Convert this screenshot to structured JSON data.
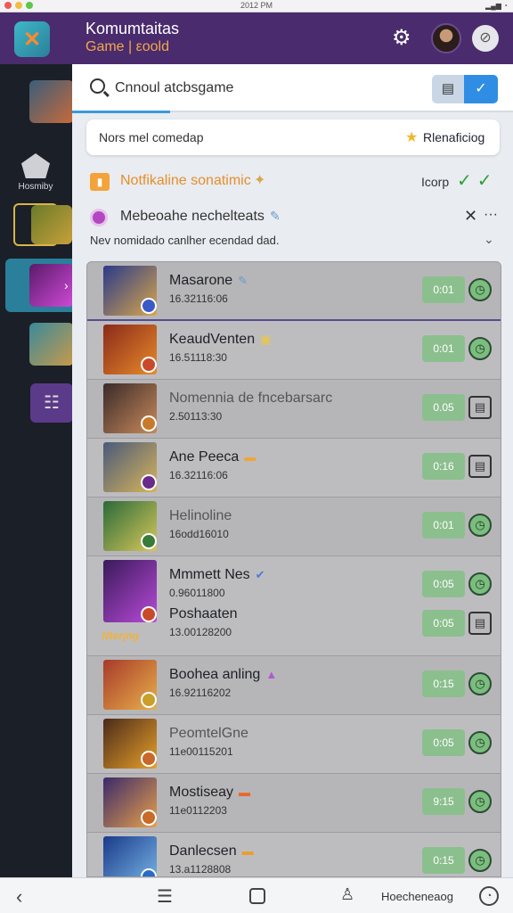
{
  "system": {
    "clock": "2012 PM"
  },
  "header": {
    "title": "Komumtaitas",
    "subtitle": "Game | εoold",
    "logo_icon": "sword-cross-icon",
    "colors": {
      "bar": "#4a2b6e",
      "subtitle": "#f2a84a"
    }
  },
  "sidebar": {
    "home_label": "Hosmiby",
    "items": [
      {
        "name": "game-thumb-knight",
        "colors": [
          "#3a5e7a",
          "#c86a3a"
        ]
      },
      {
        "name": "game-thumb-orc",
        "colors": [
          "#6a7a2a",
          "#c8a03a"
        ]
      },
      {
        "name": "game-thumb-mage",
        "colors": [
          "#5a1a6a",
          "#d04ad8"
        ]
      },
      {
        "name": "game-thumb-warrior",
        "colors": [
          "#3a8a9a",
          "#c89a4a"
        ]
      },
      {
        "name": "notes-item",
        "colors": [
          "#5c3a8a",
          "#7a5aa8"
        ]
      }
    ]
  },
  "search": {
    "value": "Cnnoul atcbsgame",
    "placeholder": "Cnnoul atcbsgame"
  },
  "notice": {
    "text": "Nors mel comedap",
    "link": "Rlenaficiog"
  },
  "notification": {
    "text": "Notfikaline sonatimic",
    "right_label": "Icorp"
  },
  "message": {
    "title": "Mebeoahe nechelteats",
    "subtitle": "Nev nomidado canlher ecendad dad."
  },
  "games": [
    {
      "name": "Masarone",
      "date": "16.32116:06",
      "time": "0:01",
      "action": "clock",
      "dim": false
    },
    {
      "name": "KeaudVenten",
      "date": "16.51118:30",
      "time": "0:01",
      "action": "clock",
      "dim": false
    },
    {
      "name": "Nomennia de fncebarsarc",
      "date": "2.50113:30",
      "time": "0.05",
      "action": "doc",
      "dim": true
    },
    {
      "name": "Ane Peeca",
      "date": "16.32116:06",
      "time": "0:16",
      "action": "doc",
      "dim": false
    },
    {
      "name": "Helinoline",
      "date": "16odd16010",
      "time": "0:01",
      "action": "clock",
      "dim": true
    },
    {
      "name": "Mmmett Nes",
      "date": "0.96011800",
      "time": "0:05",
      "action": "clock",
      "dim": false
    },
    {
      "name": "Poshaaten",
      "date": "13.00128200",
      "time": "0:05",
      "action": "doc",
      "dim": false
    },
    {
      "name": "Boohea anling",
      "date": "16.92116202",
      "time": "0:15",
      "action": "clock",
      "dim": false
    },
    {
      "name": "PeomtelGne",
      "date": "11e00115201",
      "time": "0:05",
      "action": "clock",
      "dim": true
    },
    {
      "name": "Mostiseay",
      "date": "11e0112203",
      "time": "9:15",
      "action": "clock",
      "dim": false
    },
    {
      "name": "Danlecsen",
      "date": "13.a1128808",
      "time": "0:15",
      "action": "clock",
      "dim": false
    }
  ],
  "banner_tag": "Nterjng",
  "bottombar": {
    "label": "Hoecheneaog"
  }
}
